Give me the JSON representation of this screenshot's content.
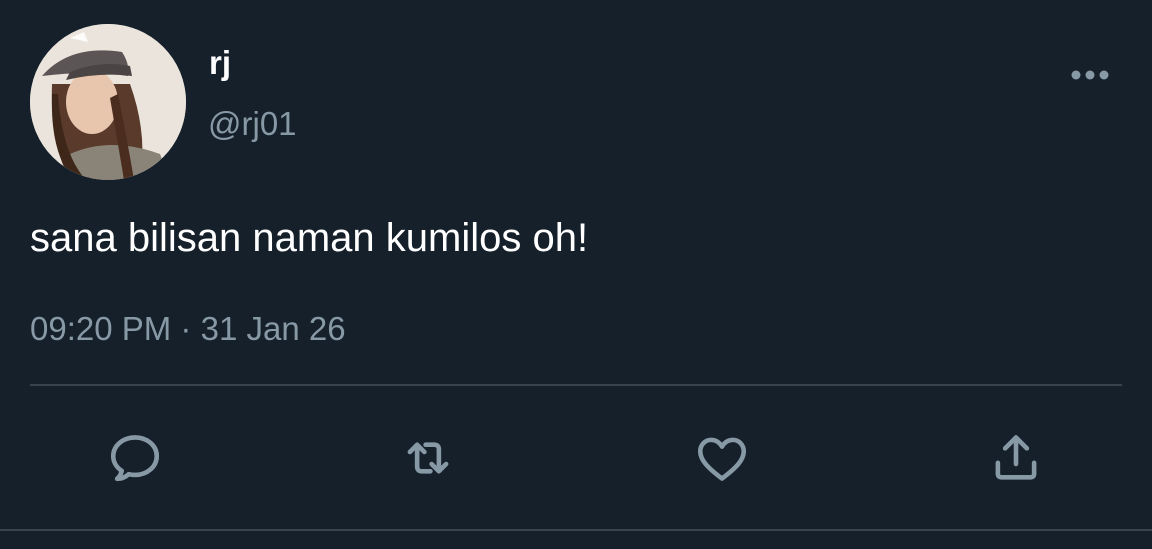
{
  "user": {
    "display_name": "rj",
    "handle": "@rj01",
    "avatar_icon": "user-avatar-photo"
  },
  "tweet": {
    "text": "sana bilisan naman kumilos oh!",
    "time": "09:20 PM",
    "separator": "·",
    "date": "31 Jan 26"
  },
  "actions": {
    "more_icon": "more-dots-icon",
    "reply_icon": "reply-icon",
    "retweet_icon": "retweet-icon",
    "like_icon": "heart-icon",
    "share_icon": "share-icon"
  },
  "colors": {
    "background": "#15202b",
    "primary_text": "#ffffff",
    "secondary_text": "#8899a6",
    "divider": "#38444d"
  }
}
